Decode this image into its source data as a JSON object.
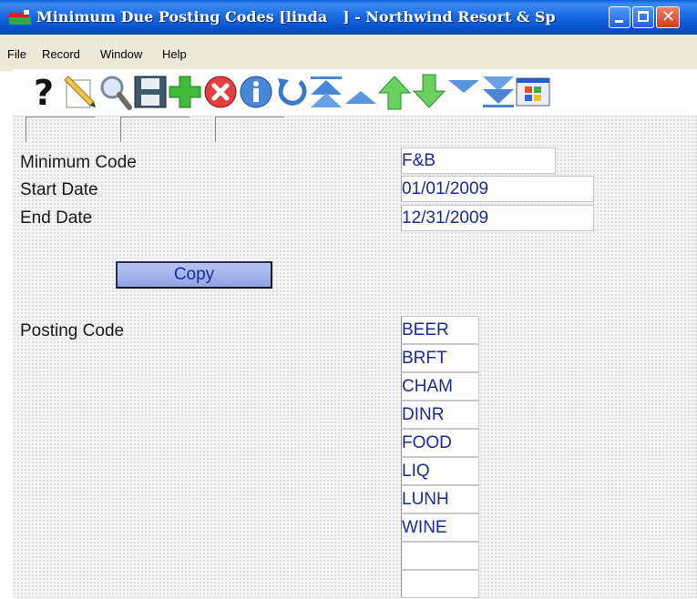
{
  "window": {
    "title": "Minimum Due Posting Codes [linda   ] - Northwind Resort & Sp"
  },
  "menu": [
    "File",
    "Record",
    "Window",
    "Help"
  ],
  "toolbar": {
    "buttons": [
      "help-icon",
      "edit-icon",
      "search-icon",
      "save-icon",
      "add-icon",
      "delete-icon",
      "info-icon",
      "undo-icon",
      "first-record-icon",
      "previous-record-icon",
      "up-arrow-icon",
      "down-arrow-icon",
      "next-record-icon",
      "last-record-icon",
      "windows-icon"
    ]
  },
  "form": {
    "minimum_code_label": "Minimum Code",
    "minimum_code_value": "F&B",
    "start_date_label": "Start Date",
    "start_date_value": "01/01/2009",
    "end_date_label": "End Date",
    "end_date_value": "12/31/2009",
    "copy_label": "Copy",
    "posting_code_label": "Posting Code",
    "posting_codes": [
      "BEER",
      "BRFT",
      "CHAM",
      "DINR",
      "FOOD",
      "LIQ",
      "LUNH",
      "WINE",
      "",
      ""
    ]
  },
  "colors": {
    "titlebar": "#0a55d0",
    "field_text": "#1a2a9a",
    "copy_button": "#9fb1ea"
  }
}
